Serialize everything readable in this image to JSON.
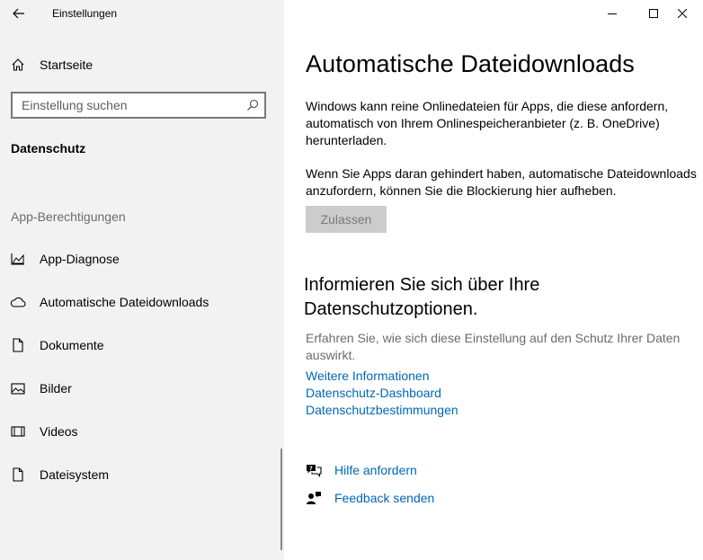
{
  "window": {
    "title": "Einstellungen",
    "minimize_label": "–",
    "maximize_label": "□",
    "close_label": "✕"
  },
  "sidebar": {
    "home_label": "Startseite",
    "search_placeholder": "Einstellung suchen",
    "section_title": "Datenschutz",
    "group_title": "App-Berechtigungen",
    "items": [
      {
        "label": "App-Diagnose",
        "icon": "chart-icon"
      },
      {
        "label": "Automatische Dateidownloads",
        "icon": "cloud-icon"
      },
      {
        "label": "Dokumente",
        "icon": "document-icon"
      },
      {
        "label": "Bilder",
        "icon": "picture-icon"
      },
      {
        "label": "Videos",
        "icon": "film-icon"
      },
      {
        "label": "Dateisystem",
        "icon": "file-icon"
      }
    ]
  },
  "main": {
    "title": "Automatische Dateidownloads",
    "description1": "Windows kann reine Onlinedateien für Apps, die diese anfordern, automatisch von Ihrem Onlinespeicheranbieter (z. B. OneDrive) herunterladen.",
    "description2": "Wenn Sie Apps daran gehindert haben, automatische Dateidownloads anzufordern, können Sie die Blockierung hier aufheben.",
    "allow_button": "Zulassen",
    "privacy_heading": "Informieren Sie sich über Ihre Datenschutzoptionen.",
    "privacy_text": "Erfahren Sie, wie sich diese Einstellung auf den Schutz Ihrer Daten auswirkt.",
    "links": [
      "Weitere Informationen",
      "Datenschutz-Dashboard",
      "Datenschutzbestimmungen"
    ],
    "help_label": "Hilfe anfordern",
    "feedback_label": "Feedback senden"
  },
  "colors": {
    "sidebar_bg": "#f2f2f2",
    "link": "#0067b8",
    "disabled_button_bg": "#cccccc",
    "muted_text": "#6b6b6b"
  }
}
